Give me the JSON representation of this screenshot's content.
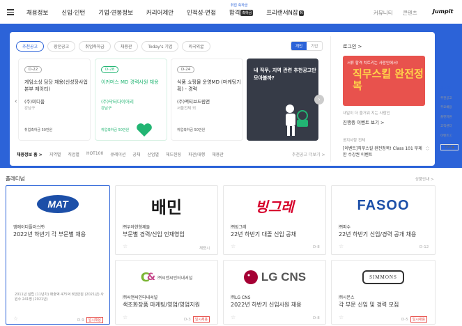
{
  "nav": {
    "items": [
      "채용정보",
      "신입·인턴",
      "기업·연봉정보",
      "커리어제안",
      "인적성·면접"
    ],
    "pass": "합격",
    "pass_sup": "취업 축하금",
    "pass_badge": "축하금",
    "freelance": "프리랜서N잡",
    "freelance_badge": "N",
    "community": "커뮤니티",
    "contents": "콘텐츠",
    "jumpit": "Jumpit"
  },
  "tabs": [
    "추천공고",
    "장전공고",
    "취업축하금",
    "채용관",
    "Today's 기업",
    "외국외굴"
  ],
  "toggle": [
    "개인",
    "기업"
  ],
  "job_cards": [
    {
      "dday": "D-22",
      "title": "게임소싱 담당 채용(신성장사업본부 제이티)",
      "company": "(주)미디움",
      "location": "강남구",
      "award": "취업축하금 50만원",
      "green": false
    },
    {
      "dday": "D-28",
      "title": "이커머스 MD 경력사원 채용",
      "company": "(주)닥터다이어리",
      "location": "강남구",
      "award": "취업축하금 50만원",
      "green": true
    },
    {
      "dday": "D-24",
      "title": "식품 쇼핑몰 운영MD (마케팅기획) - 경력",
      "company": "(주)액티브드림앤",
      "location": "서울전체 외",
      "award": "취업축하금 50만원",
      "green": false
    }
  ],
  "promo": {
    "text": "내 직무, 지역 관련 추천공고만 모아볼까?"
  },
  "sub_nav": [
    "채용정보 홈 >",
    "지역별",
    "직업별",
    "HOT100",
    "큐레이션",
    "공채",
    "산업별",
    "헤드헌팅",
    "파견/대행",
    "채용관"
  ],
  "more_link": "추천공고 더보기 >",
  "login": "로그인 >",
  "banner": {
    "top": "서류 합격 치트키는 사람인에서!",
    "big": "직무스킬 완전정복"
  },
  "banner_sub1": "내일이 더 즐거워 지는 사람인",
  "banner_sub2": "진행중 이벤트 보기 >",
  "notice": {
    "label": "공지사항  전체",
    "text": "[이벤트]직무스킬 완전정복! Class 101 무제한 수강권 이벤트"
  },
  "side_menu": [
    "공고찾기",
    "추천공고",
    "주요채용",
    "플랫지원",
    "고객센터",
    "이벤트ⓘ",
    "TOP ▲"
  ],
  "platinum": {
    "title": "플래티넘",
    "guide": "상품안내 >",
    "cards": [
      {
        "logo": "MAT",
        "company": "엠에이티플러스㈜",
        "title": "2022년 하반기 각 부문별 채용",
        "dday": "D-9",
        "rolling": "일시채용",
        "meta": "2011년 설립 (11년차) 매출액 475억 8천만원 (2021년) 사원수 241명 (2021년)"
      },
      {
        "logo": "배민",
        "company": "㈜우아한형제들",
        "title": "부문별 경력/신입 인재영입",
        "dday": "채용시",
        "rolling": ""
      },
      {
        "logo": "빙그레",
        "company": "㈜빙그레",
        "title": "22년 하반기 대졸 신입 공채",
        "dday": "D-8",
        "rolling": ""
      },
      {
        "logo": "FASOO",
        "company": "㈜파수",
        "title": "22년 하반기 신입/경력 공개 채용",
        "dday": "D-12",
        "rolling": ""
      },
      {
        "logo": "㈜씨앤씨인터내셔널",
        "company": "㈜씨앤씨인터내셔널",
        "title": "색조화장품 마케팅/영업/영업지원",
        "dday": "D-3",
        "rolling": "일시채용"
      },
      {
        "logo": "LG CNS",
        "company": "㈜LG CNS",
        "title": "2022년 하반기 신입사원 채용",
        "dday": "D-8",
        "rolling": ""
      },
      {
        "logo": "SIMMONS",
        "company": "㈜시몬스",
        "title": "각 부문 신입 및 경력 모집",
        "dday": "D-5",
        "rolling": "일시채용"
      }
    ]
  },
  "colors": {
    "brand": "#2c63d8",
    "green": "#22b573",
    "red": "#e8524d"
  }
}
